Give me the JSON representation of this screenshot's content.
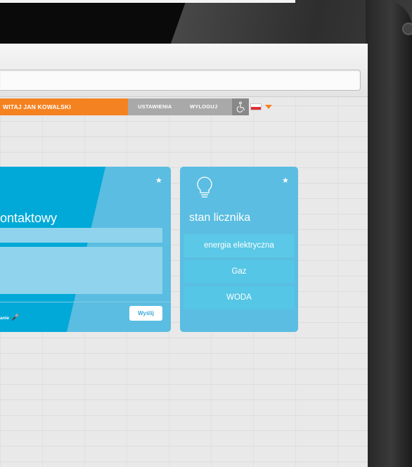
{
  "nav": {
    "welcome": "WITAJ JAN KOWALSKI",
    "settings": "USTAWIENIA",
    "logout": "WYLOGUJ",
    "access_icon": "wheelchair-icon",
    "language_flag": "poland-flag",
    "accent_color": "#f58220"
  },
  "contact_card": {
    "title": "ontaktowy",
    "dictation_label": "anie",
    "send_button": "Wyślij",
    "color": "#00a9d8"
  },
  "meter_card": {
    "title": "stan licznika",
    "icon": "lightbulb-icon",
    "options": [
      "energia elektryczna",
      "Gaz",
      "WODA"
    ],
    "color": "#5bbde1"
  }
}
